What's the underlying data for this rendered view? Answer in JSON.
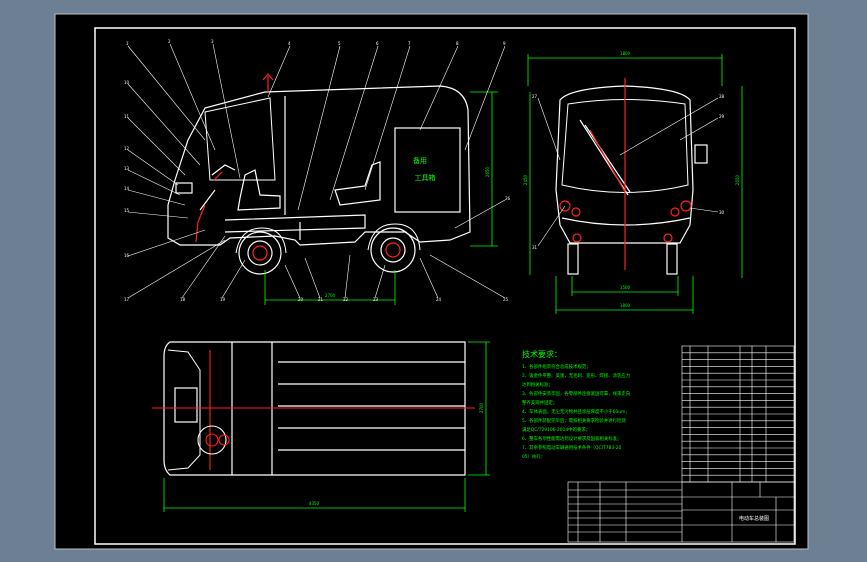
{
  "colors": {
    "frame_bg": "#6d7f93",
    "sheet": "#000000",
    "line": "#ffffff",
    "green": "#00ff00",
    "red": "#ff2020",
    "cyan": "#00ffff",
    "magenta": "#ff00ff"
  },
  "side_view": {
    "door_text_1": "备用",
    "door_text_2": "工具箱",
    "dim_wheelbase": "2700",
    "dim_height": "2650",
    "dim_bottom_length": "3700"
  },
  "front_view": {
    "dim_top": "1800",
    "dim_track": "1500",
    "dim_overall_width": "1800",
    "dim_height_left": "2450",
    "dim_height_right": "2650"
  },
  "top_view": {
    "dim_length": "4350",
    "dim_width": "2700"
  },
  "tech_requirements": {
    "title": "技术要求：",
    "lines": [
      "1、各部件组装符合总成技术规范；",
      "2、钣金件平整、美观，无毛刺、变形、焊接、涂装应力",
      "   达到相关标准；",
      "3、各部件安装牢固，各零部件连接紧固可靠，线束走向",
      "   整齐美观并固定；",
      "4、车体表面，无尘无污物并且涂层厚度不小于60um；",
      "5、各部件装配完毕后，需按相关要求检验并进行检测",
      "   满足QC/T29106-2014中的要求；",
      "6、整车各项性能需达到设计要求及国家相关标准；",
      "7、其余参照电动车辆通用技术条件（QC/T783-20",
      "   05）执行；"
    ]
  },
  "parts_list_rows": 20,
  "title_block": {
    "drawing_name": "电动车总装图"
  }
}
